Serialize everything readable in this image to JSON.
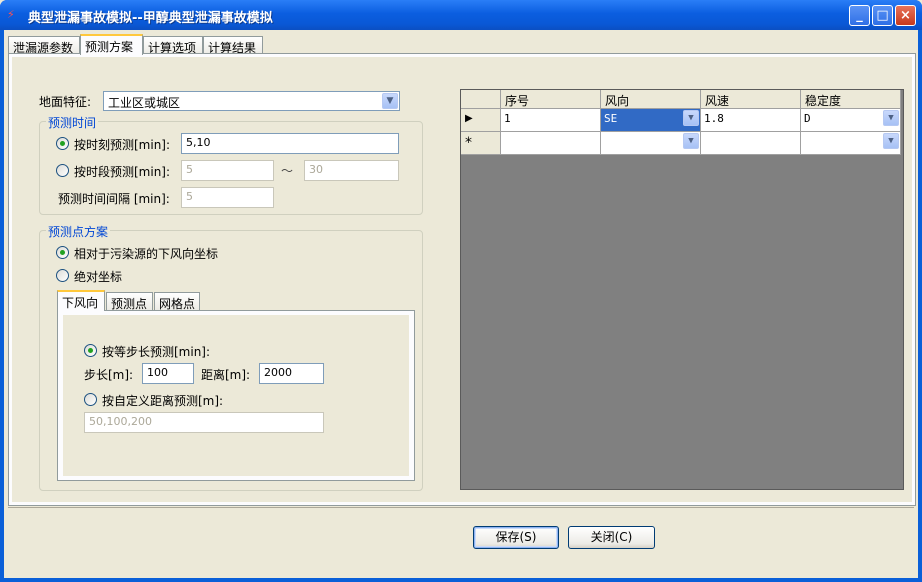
{
  "window": {
    "title": "典型泄漏事故模拟--甲醇典型泄漏事故模拟",
    "minimize": "_",
    "maximize": "□",
    "close": "×"
  },
  "tabs": [
    "泄漏源参数",
    "预测方案",
    "计算选项",
    "计算结果"
  ],
  "terrain": {
    "label": "地面特征:",
    "value": "工业区或城区"
  },
  "time_group": {
    "title": "预测时间",
    "moment_label": "按时刻预测[min]:",
    "moment_value": "5,10",
    "period_label": "按时段预测[min]:",
    "period_from": "5",
    "tilde": "～",
    "period_to": "30",
    "interval_label": "预测时间间隔 [min]:",
    "interval_value": "5"
  },
  "point_group": {
    "title": "预测点方案",
    "relative_label": "相对于污染源的下风向坐标",
    "absolute_label": "绝对坐标",
    "subtabs": [
      "下风向",
      "预测点",
      "网格点"
    ],
    "step_radio_label": "按等步长预测[min]:",
    "step_label": "步长[m]:",
    "step_value": "100",
    "distance_label": "距离[m]:",
    "distance_value": "2000",
    "custom_radio_label": "按自定义距离预测[m]:",
    "custom_value": "50,100,200"
  },
  "grid": {
    "columns": [
      "序号",
      "风向",
      "风速",
      "稳定度"
    ],
    "rows": [
      {
        "marker": "▶",
        "cells": [
          "1",
          "SE",
          "1.8",
          "D"
        ]
      },
      {
        "marker": "*",
        "cells": [
          "",
          "",
          "",
          ""
        ]
      }
    ]
  },
  "buttons": {
    "save": "保存(S)",
    "close": "关闭(C)"
  }
}
